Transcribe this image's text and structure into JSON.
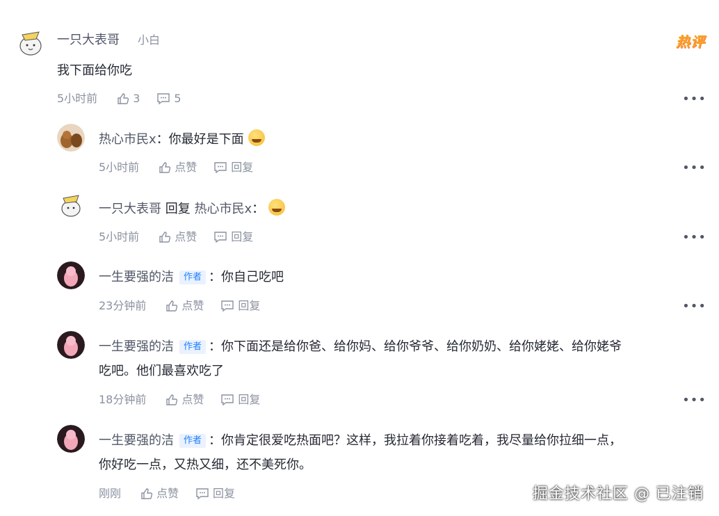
{
  "top_comment": {
    "author": "一只大表哥",
    "level": "小白",
    "hot_badge": "热评",
    "text": "我下面给你吃",
    "time": "5小时前",
    "like_count": "3",
    "reply_count": "5"
  },
  "replies": [
    {
      "author": "热心市民x",
      "tag": "",
      "separator": "：",
      "reply_to_label": "",
      "reply_to": "",
      "lines": [
        "你最好是下面"
      ],
      "emoji": "grin-sweat-emoji",
      "time": "5小时前",
      "like_label": "点赞",
      "reply_label": "回复"
    },
    {
      "author": "一只大表哥",
      "tag": "",
      "separator": "：",
      "reply_to_label": "回复",
      "reply_to": "热心市民x",
      "lines": [
        ""
      ],
      "emoji": "smirk-emoji",
      "time": "5小时前",
      "like_label": "点赞",
      "reply_label": "回复"
    },
    {
      "author": "一生要强的洁",
      "tag": "作者",
      "separator": "：",
      "reply_to_label": "",
      "reply_to": "",
      "lines": [
        "你自己吃吧"
      ],
      "emoji": "",
      "time": "23分钟前",
      "like_label": "点赞",
      "reply_label": "回复"
    },
    {
      "author": "一生要强的洁",
      "tag": "作者",
      "separator": "：",
      "reply_to_label": "",
      "reply_to": "",
      "lines": [
        "你下面还是给你爸、给你妈、给你爷爷、给你奶奶、给你姥姥、给你姥爷",
        "吃吧。他们最喜欢吃了"
      ],
      "emoji": "",
      "time": "18分钟前",
      "like_label": "点赞",
      "reply_label": "回复"
    },
    {
      "author": "一生要强的洁",
      "tag": "作者",
      "separator": "：",
      "reply_to_label": "",
      "reply_to": "",
      "lines": [
        "你肯定很爱吃热面吧？这样，我拉着你接着吃着，我尽量给你拉细一点，",
        "你好吃一点，又热又细，还不美死你。"
      ],
      "emoji": "",
      "time": "刚刚",
      "like_label": "点赞",
      "reply_label": "回复"
    }
  ],
  "more_label": "•••",
  "watermark": "掘金技术社区 @ 已注销",
  "colors": {
    "accent": "#1e80ff",
    "muted": "#8a919f",
    "text": "#252933"
  }
}
